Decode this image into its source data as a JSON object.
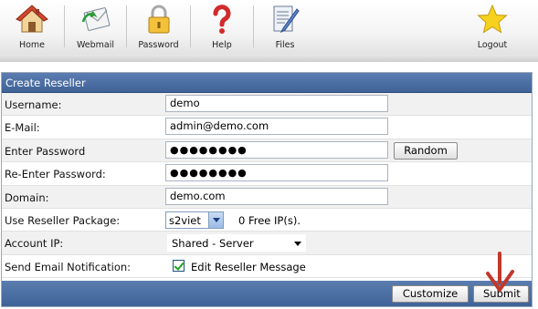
{
  "toolbar": {
    "items": [
      {
        "label": "Home",
        "icon": "house-icon"
      },
      {
        "label": "Webmail",
        "icon": "envelope-icon"
      },
      {
        "label": "Password",
        "icon": "padlock-icon"
      },
      {
        "label": "Help",
        "icon": "question-mark-icon"
      },
      {
        "label": "Files",
        "icon": "document-pencil-icon"
      },
      {
        "label": "Logout",
        "icon": "star-icon"
      }
    ]
  },
  "panel": {
    "title": "Create Reseller"
  },
  "form": {
    "username": {
      "label": "Username:",
      "value": "demo"
    },
    "email": {
      "label": "E-Mail:",
      "value": "admin@demo.com"
    },
    "password": {
      "label": "Enter Password",
      "value": "●●●●●●●●"
    },
    "password_confirm": {
      "label": "Re-Enter Password:",
      "value": "●●●●●●●●"
    },
    "random_button": "Random",
    "domain": {
      "label": "Domain:",
      "value": "demo.com"
    },
    "package": {
      "label": "Use Reseller Package:",
      "selected": "s2viet",
      "free_ip_text": "0 Free IP(s)."
    },
    "account_ip": {
      "label": "Account IP:",
      "selected": "Shared - Server"
    },
    "notification": {
      "label": "Send Email Notification:",
      "checkbox_label": "Edit Reseller Message",
      "checked": true
    }
  },
  "footer": {
    "customize_button": "Customize",
    "submit_button": "Submit"
  },
  "colors": {
    "header_blue": "#4a6ea3",
    "annotation_arrow": "#c0392b"
  }
}
